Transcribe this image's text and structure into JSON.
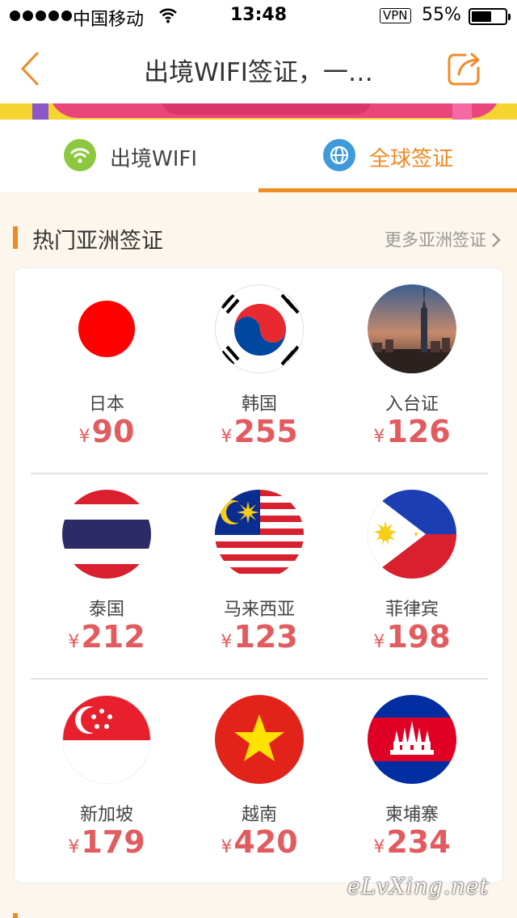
{
  "status_bar": {
    "carrier": "中国移动",
    "time": "13:48",
    "vpn": "VPN",
    "battery": "55%"
  },
  "nav": {
    "title": "出境WIFI签证，一…",
    "back_icon": "chevron-left-icon",
    "share_icon": "share-icon"
  },
  "tabs": [
    {
      "label": "出境WIFI",
      "icon": "wifi-icon",
      "active": false
    },
    {
      "label": "全球签证",
      "icon": "globe-icon",
      "active": true
    }
  ],
  "section": {
    "title": "热门亚洲签证",
    "more": "更多亚洲签证"
  },
  "currency": "¥",
  "countries": [
    {
      "name": "日本",
      "price": "90",
      "flag": "japan-flag"
    },
    {
      "name": "韩国",
      "price": "255",
      "flag": "korea-flag"
    },
    {
      "name": "入台证",
      "price": "126",
      "flag": "taipei-photo"
    },
    {
      "name": "泰国",
      "price": "212",
      "flag": "thailand-flag"
    },
    {
      "name": "马来西亚",
      "price": "123",
      "flag": "malaysia-flag"
    },
    {
      "name": "菲律宾",
      "price": "198",
      "flag": "philippines-flag"
    },
    {
      "name": "新加坡",
      "price": "179",
      "flag": "singapore-flag"
    },
    {
      "name": "越南",
      "price": "420",
      "flag": "vietnam-flag"
    },
    {
      "name": "柬埔寨",
      "price": "234",
      "flag": "cambodia-flag"
    }
  ],
  "watermark": "eLvXing.net",
  "colors": {
    "accent": "#f08a24",
    "price": "#e25b5e",
    "wifi_green": "#8dc63f",
    "globe_blue": "#3f9ad9",
    "background": "#fcf6ec"
  }
}
